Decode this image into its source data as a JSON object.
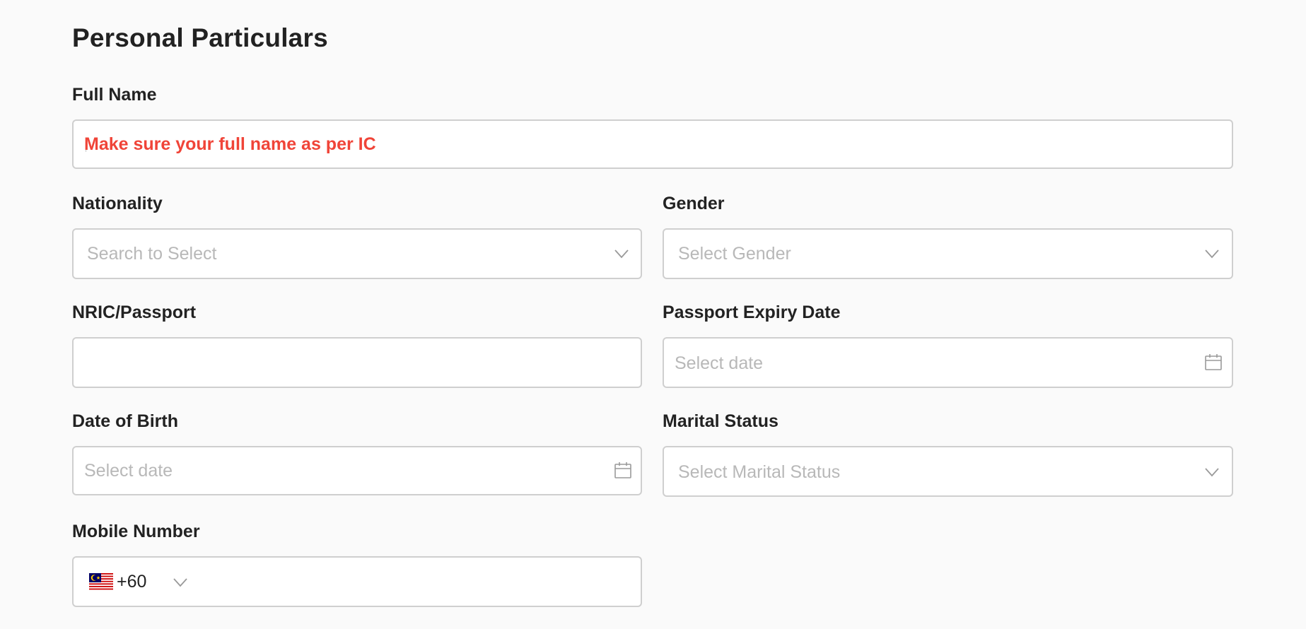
{
  "page_title": "Personal Particulars",
  "full_name": {
    "label": "Full Name",
    "placeholder": "Make sure your full name as per IC",
    "value": ""
  },
  "nationality": {
    "label": "Nationality",
    "placeholder": "Search to Select",
    "icon": "chevron-down-icon"
  },
  "gender": {
    "label": "Gender",
    "placeholder": "Select Gender",
    "icon": "chevron-down-icon"
  },
  "nric_passport": {
    "label": "NRIC/Passport",
    "value": ""
  },
  "passport_expiry_date": {
    "label": "Passport Expiry Date",
    "placeholder": "Select date",
    "icon": "calendar-icon"
  },
  "date_of_birth": {
    "label": "Date of Birth",
    "placeholder": "Select date",
    "icon": "calendar-icon"
  },
  "marital_status": {
    "label": "Marital Status",
    "placeholder": "Select Marital Status",
    "icon": "chevron-down-icon"
  },
  "mobile_number": {
    "label": "Mobile Number",
    "country_flag": "malaysia-flag-icon",
    "dial_code": "+60",
    "value": ""
  },
  "colors": {
    "accent_error": "#f04438",
    "border": "#cfcfcf",
    "placeholder": "#b8b8b8",
    "background": "#fafafa"
  }
}
